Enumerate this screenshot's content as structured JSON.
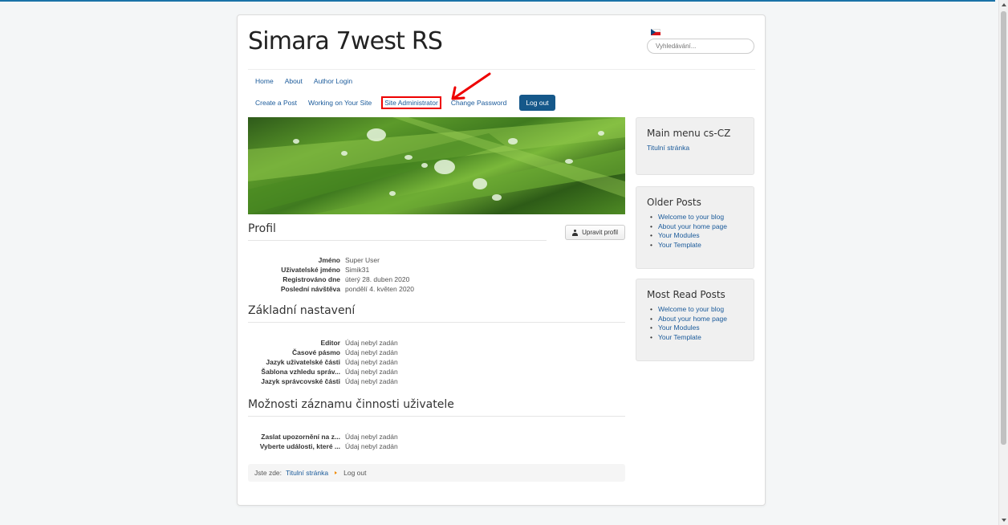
{
  "site": {
    "title": "Simara 7west RS",
    "search_placeholder": "Vyhledávání..."
  },
  "nav": {
    "row1": [
      "Home",
      "About",
      "Author Login"
    ],
    "row2": [
      "Create a Post",
      "Working on Your Site",
      "Site Administrator",
      "Change Password"
    ],
    "logout": "Log out"
  },
  "profile": {
    "title": "Profil",
    "edit_button": "Upravit profil",
    "fields": [
      {
        "label": "Jméno",
        "value": "Super User"
      },
      {
        "label": "Uživatelské jméno",
        "value": "Simik31"
      },
      {
        "label": "Registrováno dne",
        "value": "úterý 28. duben 2020"
      },
      {
        "label": "Poslední návštěva",
        "value": "pondělí 4. květen 2020"
      }
    ]
  },
  "basic_settings": {
    "title": "Základní nastavení",
    "fields": [
      {
        "label": "Editor",
        "value": "Údaj nebyl zadán"
      },
      {
        "label": "Časové pásmo",
        "value": "Údaj nebyl zadán"
      },
      {
        "label": "Jazyk uživatelské části",
        "value": "Údaj nebyl zadán"
      },
      {
        "label": "Šablona vzhledu správ...",
        "value": "Údaj nebyl zadán"
      },
      {
        "label": "Jazyk správcovské části",
        "value": "Údaj nebyl zadán"
      }
    ]
  },
  "activity_log": {
    "title": "Možnosti záznamu činnosti uživatele",
    "fields": [
      {
        "label": "Zaslat upozornění na z...",
        "value": "Údaj nebyl zadán"
      },
      {
        "label": "Vyberte události, které ...",
        "value": "Údaj nebyl zadán"
      }
    ]
  },
  "breadcrumb": {
    "prefix": "Jste zde:",
    "home": "Titulní stránka",
    "current": "Log out"
  },
  "sidebar": {
    "main_menu": {
      "title": "Main menu cs-CZ",
      "link": "Titulní stránka"
    },
    "older_posts": {
      "title": "Older Posts",
      "items": [
        "Welcome to your blog",
        "About your home page",
        "Your Modules",
        "Your Template"
      ]
    },
    "most_read": {
      "title": "Most Read Posts",
      "items": [
        "Welcome to your blog",
        "About your home page",
        "Your Modules",
        "Your Template"
      ]
    }
  },
  "colors": {
    "accent": "#15588a",
    "link": "#1a5a9a",
    "highlight": "#e00000"
  }
}
